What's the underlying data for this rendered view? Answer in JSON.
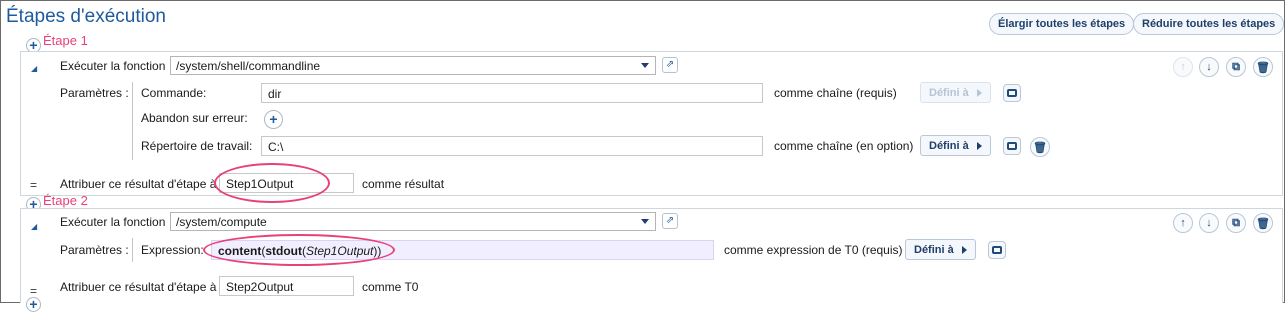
{
  "page": {
    "title": "Étapes d'exécution",
    "expand_all_label": "Élargir toutes les étapes",
    "collapse_all_label": "Réduire toutes les étapes"
  },
  "steps": [
    {
      "label": "Étape 1",
      "execute_label": "Exécuter la fonction",
      "function_value": "/system/shell/commandline",
      "params_label": "Paramètres :",
      "params": [
        {
          "name": "Commande:",
          "value": "dir",
          "hint": "comme chaîne (requis)",
          "define_label": "Défini à"
        },
        {
          "name": "Abandon sur erreur:"
        },
        {
          "name": "Répertoire de travail:",
          "value": "C:\\",
          "hint": "comme chaîne (en option)",
          "define_label": "Défini à"
        }
      ],
      "assign_label": "Attribuer ce résultat d'étape à",
      "assign_value": "Step1Output",
      "assign_suffix": "comme résultat"
    },
    {
      "label": "Étape 2",
      "execute_label": "Exécuter la fonction",
      "function_value": "/system/compute",
      "params_label": "Paramètres :",
      "params": [
        {
          "name": "Expression:",
          "expr_fn1": "content",
          "expr_p1": "(",
          "expr_fn2": "stdout",
          "expr_p2": "(",
          "expr_arg": "Step1Output",
          "expr_close": "))",
          "hint": "comme expression de T0 (requis)",
          "define_label": "Défini à"
        }
      ],
      "assign_label": "Attribuer ce résultat d'étape à",
      "assign_value": "Step2Output",
      "assign_suffix": "comme T0"
    }
  ],
  "symbols": {
    "equals": "=",
    "plus": "+",
    "collapse_triangle": "◢",
    "up_arrow": "↑",
    "down_arrow": "↓",
    "trash": "🗑",
    "copy": "⧉",
    "external": "⇗"
  },
  "colors": {
    "accent": "#1f5a9e",
    "step_label": "#e8417a",
    "highlight_ellipse": "#e8417a",
    "expression_bg": "#f1efff"
  }
}
